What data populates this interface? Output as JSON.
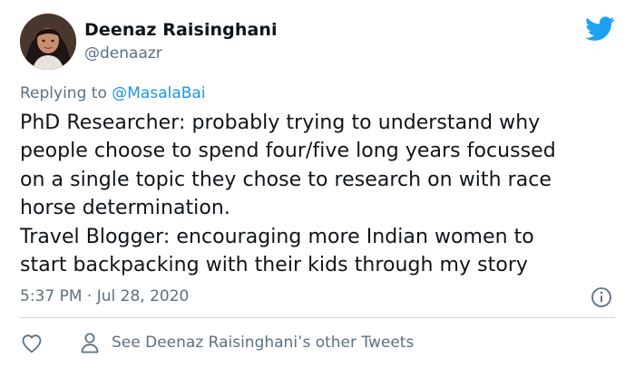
{
  "tweet": {
    "author_name": "Deenaz Raisinghani",
    "author_handle": "@denaazr",
    "replying_prefix": "Replying to",
    "replying_to": "@MasalaBai",
    "text_lines": [
      "PhD Researcher: probably trying to understand why",
      "people choose to spend four/five long years focussed",
      "on a single topic they chose to research on with race",
      "horse determination.",
      "Travel Blogger: encouraging more Indian women to",
      "start backpacking with their kids through my story"
    ],
    "timestamp": "5:37 PM · Jul 28, 2020"
  },
  "footer": {
    "other_tweets_label": "See Deenaz Raisinghani’s other Tweets"
  },
  "icons": {
    "brand": "twitter-bird-icon",
    "info": "info-icon",
    "like": "heart-icon",
    "person": "person-icon"
  },
  "colors": {
    "brand_blue": "#1da1f2",
    "link_blue": "#1b95e0",
    "secondary_text": "#5b7083",
    "primary_text": "#0f1419",
    "divider": "#cfd9de"
  }
}
